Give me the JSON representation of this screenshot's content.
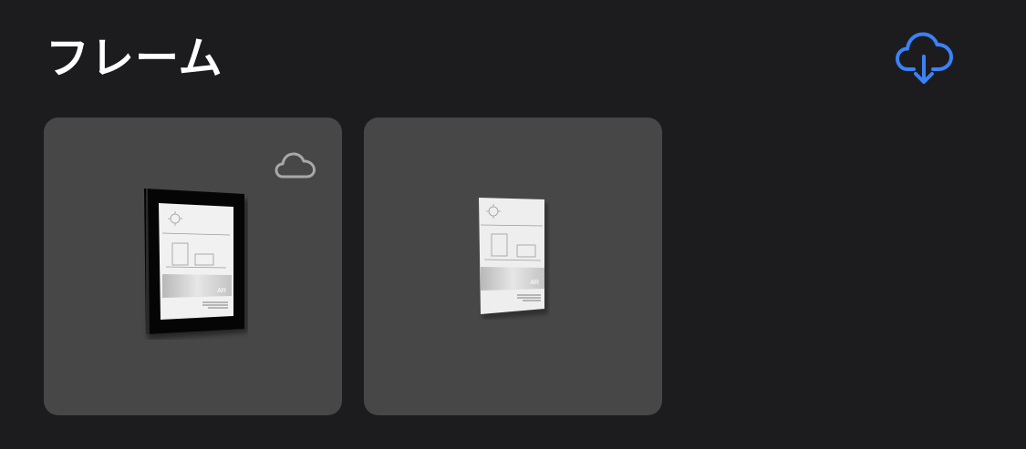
{
  "header": {
    "title": "フレーム",
    "download_icon": "cloud-download-icon",
    "accent_color": "#3a82f7"
  },
  "frames": [
    {
      "thumbnail": "framed-ar-poster-black-frame",
      "status_icon": "cloud-icon",
      "thumbnail_text": "AR"
    },
    {
      "thumbnail": "ar-poster-no-frame",
      "thumbnail_text": "AR"
    }
  ],
  "colors": {
    "background": "#1c1c1e",
    "card": "#474747",
    "title": "#ffffff",
    "badge": "#a8a8a8"
  }
}
